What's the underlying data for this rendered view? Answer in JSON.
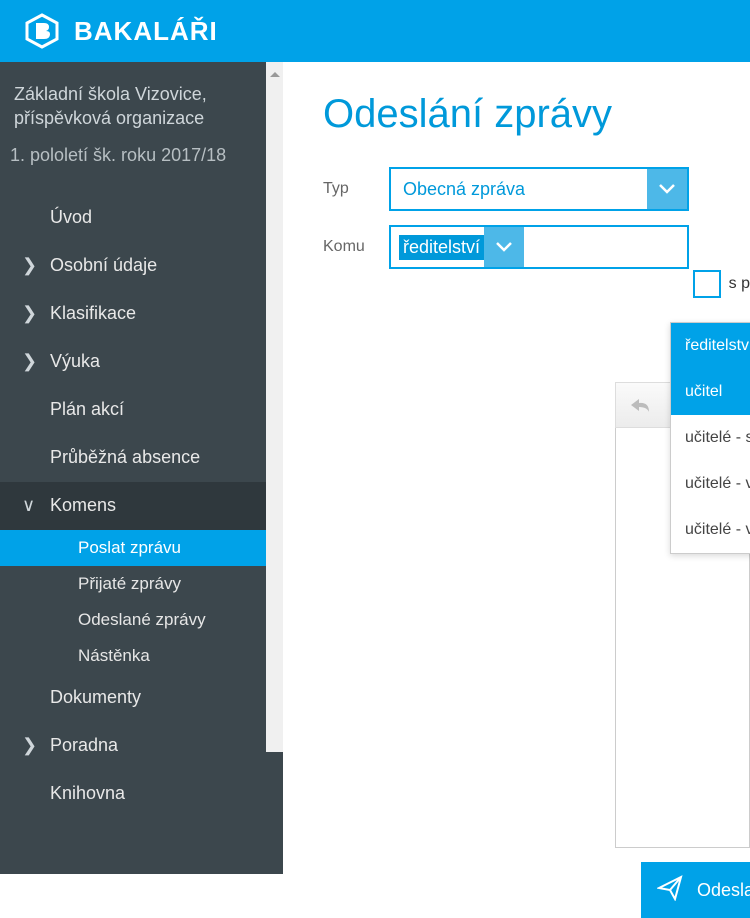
{
  "brand": "BAKALÁŘI",
  "school": {
    "line1": "Základní škola Vizovice,",
    "line2": "příspěvková organizace"
  },
  "term": "1. pololetí šk. roku 2017/18",
  "nav": {
    "uvod": "Úvod",
    "osobni": "Osobní údaje",
    "klasifikace": "Klasifikace",
    "vyuka": "Výuka",
    "plan": "Plán akcí",
    "absence": "Průběžná absence",
    "komens": "Komens",
    "poslat": "Poslat zprávu",
    "prijate": "Přijaté zprávy",
    "odeslane": "Odeslané zprávy",
    "nastenka": "Nástěnka",
    "dokumenty": "Dokumenty",
    "poradna": "Poradna",
    "knihovna": "Knihovna"
  },
  "page": {
    "title": "Odeslání zprávy",
    "form": {
      "typ_label": "Typ",
      "typ_value": "Obecná zpráva",
      "komu_label": "Komu",
      "komu_value": "ředitelství",
      "cb_label": "s p"
    },
    "dropdown": {
      "opt0": "ředitelství",
      "opt1": "učitel",
      "opt2": "učitelé - skupiny",
      "opt3": "učitelé - všichni",
      "opt4": "učitelé - volný výběr"
    },
    "send": "Odeslat"
  }
}
